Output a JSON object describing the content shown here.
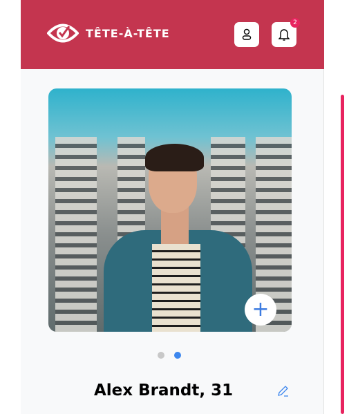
{
  "header": {
    "brand": "TÊTE-À-TÊTE",
    "notification_count": "2"
  },
  "profile": {
    "name_age": "Alex Brandt, 31",
    "photo_count": 2,
    "active_photo_index": 1
  },
  "colors": {
    "header": "#c4354f",
    "accent": "#3d87ee",
    "scrollbar": "#e8245f"
  }
}
